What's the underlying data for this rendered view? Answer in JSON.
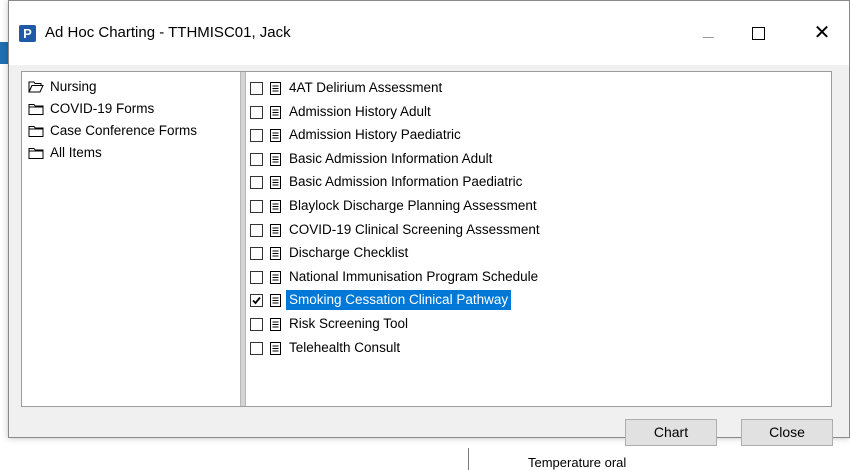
{
  "window": {
    "title": "Ad Hoc Charting - TTHMISC01, Jack",
    "app_icon_letter": "P",
    "close_glyph": "✕"
  },
  "folders": [
    {
      "label": "Nursing",
      "icon": "folder-open-icon"
    },
    {
      "label": "COVID-19 Forms",
      "icon": "folder-icon"
    },
    {
      "label": "Case Conference Forms",
      "icon": "folder-icon"
    },
    {
      "label": "All Items",
      "icon": "folder-icon"
    }
  ],
  "forms": [
    {
      "label": "4AT Delirium Assessment",
      "checked": false,
      "selected": false
    },
    {
      "label": "Admission History Adult",
      "checked": false,
      "selected": false
    },
    {
      "label": "Admission History Paediatric",
      "checked": false,
      "selected": false
    },
    {
      "label": "Basic Admission Information Adult",
      "checked": false,
      "selected": false
    },
    {
      "label": "Basic Admission Information Paediatric",
      "checked": false,
      "selected": false
    },
    {
      "label": "Blaylock Discharge Planning Assessment",
      "checked": false,
      "selected": false
    },
    {
      "label": "COVID-19 Clinical Screening Assessment",
      "checked": false,
      "selected": false
    },
    {
      "label": "Discharge Checklist",
      "checked": false,
      "selected": false
    },
    {
      "label": "National Immunisation Program Schedule",
      "checked": false,
      "selected": false
    },
    {
      "label": "Smoking Cessation Clinical Pathway",
      "checked": true,
      "selected": true
    },
    {
      "label": "Risk Screening Tool",
      "checked": false,
      "selected": false
    },
    {
      "label": "Telehealth Consult",
      "checked": false,
      "selected": false
    }
  ],
  "buttons": {
    "chart": "Chart",
    "close": "Close"
  },
  "background": {
    "partial_text": "Temperature oral"
  },
  "colors": {
    "selection": "#0078d7",
    "app_icon": "#1e5aa8"
  }
}
